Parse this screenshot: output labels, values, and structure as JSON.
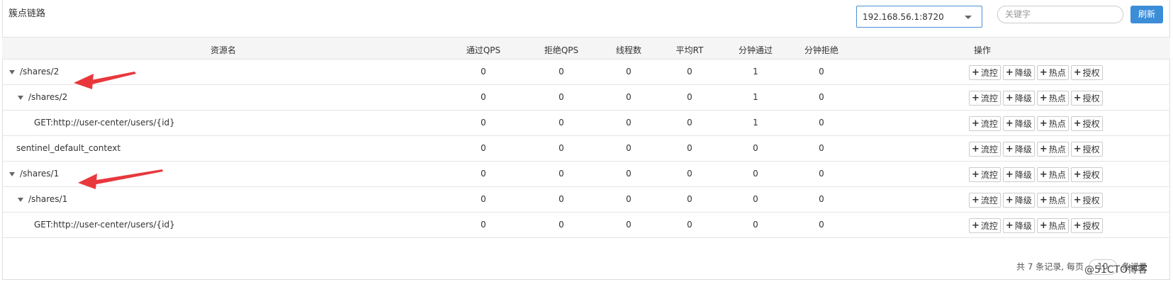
{
  "header": {
    "title": "簇点链路",
    "machine_select": "192.168.56.1:8720",
    "search_placeholder": "关键字",
    "refresh_label": "刷新"
  },
  "columns": [
    "资源名",
    "通过QPS",
    "拒绝QPS",
    "线程数",
    "平均RT",
    "分钟通过",
    "分钟拒绝",
    "操作"
  ],
  "rows": [
    {
      "name": "/shares/2",
      "pass_qps": "0",
      "block_qps": "0",
      "threads": "0",
      "avg_rt": "0",
      "min_pass": "1",
      "min_block": "0"
    },
    {
      "name": "/shares/2",
      "pass_qps": "0",
      "block_qps": "0",
      "threads": "0",
      "avg_rt": "0",
      "min_pass": "1",
      "min_block": "0"
    },
    {
      "name": "GET:http://user-center/users/{id}",
      "pass_qps": "0",
      "block_qps": "0",
      "threads": "0",
      "avg_rt": "0",
      "min_pass": "1",
      "min_block": "0"
    },
    {
      "name": "sentinel_default_context",
      "pass_qps": "0",
      "block_qps": "0",
      "threads": "0",
      "avg_rt": "0",
      "min_pass": "0",
      "min_block": "0"
    },
    {
      "name": "/shares/1",
      "pass_qps": "0",
      "block_qps": "0",
      "threads": "0",
      "avg_rt": "0",
      "min_pass": "0",
      "min_block": "0"
    },
    {
      "name": "/shares/1",
      "pass_qps": "0",
      "block_qps": "0",
      "threads": "0",
      "avg_rt": "0",
      "min_pass": "0",
      "min_block": "0"
    },
    {
      "name": "GET:http://user-center/users/{id}",
      "pass_qps": "0",
      "block_qps": "0",
      "threads": "0",
      "avg_rt": "0",
      "min_pass": "0",
      "min_block": "0"
    }
  ],
  "actions": {
    "flow": "流控",
    "degrade": "降级",
    "hotspot": "热点",
    "auth": "授权"
  },
  "footer": {
    "text_before": "共 7 条记录, 每页",
    "page_size": "10",
    "text_after": "条记录"
  },
  "watermark": "@51CTO博客",
  "colors": {
    "accent": "#3c8dd8",
    "arrow": "#e8383d"
  }
}
